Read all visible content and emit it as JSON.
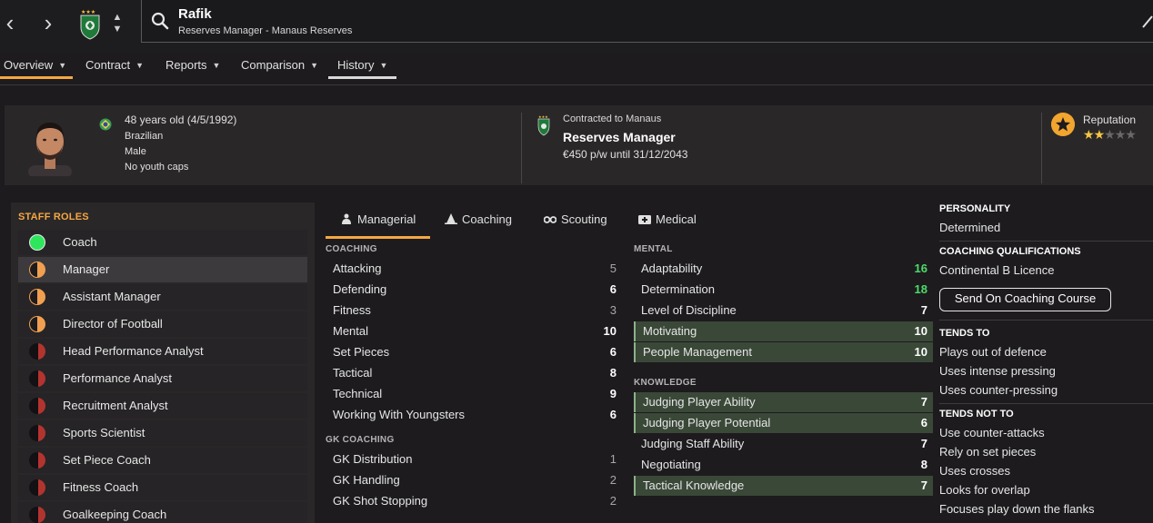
{
  "header": {
    "name": "Rafik",
    "subtitle": "Reserves Manager - Manaus Reserves"
  },
  "tabs": [
    {
      "label": "Overview"
    },
    {
      "label": "Contract"
    },
    {
      "label": "Reports"
    },
    {
      "label": "Comparison"
    },
    {
      "label": "History"
    }
  ],
  "person": {
    "age": "48 years old (4/5/1992)",
    "nationality": "Brazilian",
    "gender": "Male",
    "caps": "No youth caps"
  },
  "contract": {
    "label": "Contracted to Manaus",
    "role": "Reserves Manager",
    "wage": "€450 p/w until 31/12/2043"
  },
  "reputation": {
    "label": "Reputation",
    "stars": 2,
    "max_stars": 5
  },
  "staff_roles": {
    "title": "STAFF ROLES",
    "items": [
      {
        "label": "Coach",
        "suitability": "full"
      },
      {
        "label": "Manager",
        "suitability": "half",
        "selected": true
      },
      {
        "label": "Assistant Manager",
        "suitability": "half"
      },
      {
        "label": "Director of Football",
        "suitability": "half"
      },
      {
        "label": "Head Performance Analyst",
        "suitability": "low"
      },
      {
        "label": "Performance Analyst",
        "suitability": "low"
      },
      {
        "label": "Recruitment Analyst",
        "suitability": "low"
      },
      {
        "label": "Sports Scientist",
        "suitability": "low"
      },
      {
        "label": "Set Piece Coach",
        "suitability": "low"
      },
      {
        "label": "Fitness Coach",
        "suitability": "low"
      },
      {
        "label": "Goalkeeping Coach",
        "suitability": "low"
      }
    ]
  },
  "attr_tabs": [
    {
      "label": "Managerial"
    },
    {
      "label": "Coaching"
    },
    {
      "label": "Scouting"
    },
    {
      "label": "Medical"
    }
  ],
  "coaching": {
    "title": "COACHING",
    "items": [
      {
        "name": "Attacking",
        "value": "5"
      },
      {
        "name": "Defending",
        "value": "6"
      },
      {
        "name": "Fitness",
        "value": "3"
      },
      {
        "name": "Mental",
        "value": "10"
      },
      {
        "name": "Set Pieces",
        "value": "6"
      },
      {
        "name": "Tactical",
        "value": "8"
      },
      {
        "name": "Technical",
        "value": "9"
      },
      {
        "name": "Working With Youngsters",
        "value": "6"
      }
    ]
  },
  "gk_coaching": {
    "title": "GK COACHING",
    "items": [
      {
        "name": "GK Distribution",
        "value": "1"
      },
      {
        "name": "GK Handling",
        "value": "2"
      },
      {
        "name": "GK Shot Stopping",
        "value": "2"
      }
    ]
  },
  "mental": {
    "title": "MENTAL",
    "items": [
      {
        "name": "Adaptability",
        "value": "16"
      },
      {
        "name": "Determination",
        "value": "18"
      },
      {
        "name": "Level of Discipline",
        "value": "7"
      },
      {
        "name": "Motivating",
        "value": "10"
      },
      {
        "name": "People Management",
        "value": "10"
      }
    ]
  },
  "knowledge": {
    "title": "KNOWLEDGE",
    "items": [
      {
        "name": "Judging Player Ability",
        "value": "7"
      },
      {
        "name": "Judging Player Potential",
        "value": "6"
      },
      {
        "name": "Judging Staff Ability",
        "value": "7"
      },
      {
        "name": "Negotiating",
        "value": "8"
      },
      {
        "name": "Tactical Knowledge",
        "value": "7"
      }
    ]
  },
  "personality": {
    "title": "PERSONALITY",
    "value": "Determined"
  },
  "qualifications": {
    "title": "COACHING QUALIFICATIONS",
    "value": "Continental B Licence",
    "button": "Send On Coaching Course"
  },
  "tends_to": {
    "title": "TENDS TO",
    "items": [
      "Plays out of defence",
      "Uses intense pressing",
      "Uses counter-pressing"
    ]
  },
  "tends_not_to": {
    "title": "TENDS NOT TO",
    "items": [
      "Use counter-attacks",
      "Rely on set pieces",
      "Uses crosses",
      "Looks for overlap",
      "Focuses play down the flanks"
    ]
  },
  "colors": {
    "accent": "#f5a742",
    "highlight_row": "#3a4838",
    "green_value": "#4cdc6a",
    "role_full": "#2ee65c",
    "role_half": "#f0a050",
    "role_low": "#b3342f"
  }
}
